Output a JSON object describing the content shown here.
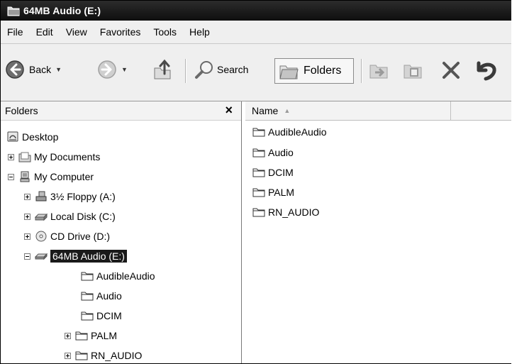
{
  "window": {
    "title": "64MB Audio (E:)"
  },
  "menu": [
    "File",
    "Edit",
    "View",
    "Favorites",
    "Tools",
    "Help"
  ],
  "toolbar": {
    "back_label": "Back",
    "search_label": "Search",
    "folders_label": "Folders"
  },
  "folders_pane": {
    "title": "Folders",
    "close_glyph": "×",
    "tree": [
      {
        "label": "Desktop",
        "icon": "desktop-icon",
        "expander": "none"
      },
      {
        "label": "My Documents",
        "icon": "my-documents-icon",
        "expander": "plus"
      },
      {
        "label": "My Computer",
        "icon": "my-computer-icon",
        "expander": "minus"
      },
      {
        "label": "3½ Floppy (A:)",
        "icon": "floppy-drive-icon",
        "expander": "plus"
      },
      {
        "label": "Local Disk (C:)",
        "icon": "hard-disk-icon",
        "expander": "plus"
      },
      {
        "label": "CD Drive (D:)",
        "icon": "cd-drive-icon",
        "expander": "plus"
      },
      {
        "label": "64MB Audio (E:)",
        "icon": "removable-drive-icon",
        "expander": "minus",
        "selected": true
      },
      {
        "label": "AudibleAudio",
        "icon": "folder-icon",
        "expander": "none"
      },
      {
        "label": "Audio",
        "icon": "folder-icon",
        "expander": "none"
      },
      {
        "label": "DCIM",
        "icon": "folder-icon",
        "expander": "none"
      },
      {
        "label": "PALM",
        "icon": "folder-icon",
        "expander": "plus"
      },
      {
        "label": "RN_AUDIO",
        "icon": "folder-icon",
        "expander": "plus"
      }
    ]
  },
  "file_list": {
    "columns": [
      "Name"
    ],
    "sort_indicator": "▲",
    "items": [
      "AudibleAudio",
      "Audio",
      "DCIM",
      "PALM",
      "RN_AUDIO"
    ]
  }
}
